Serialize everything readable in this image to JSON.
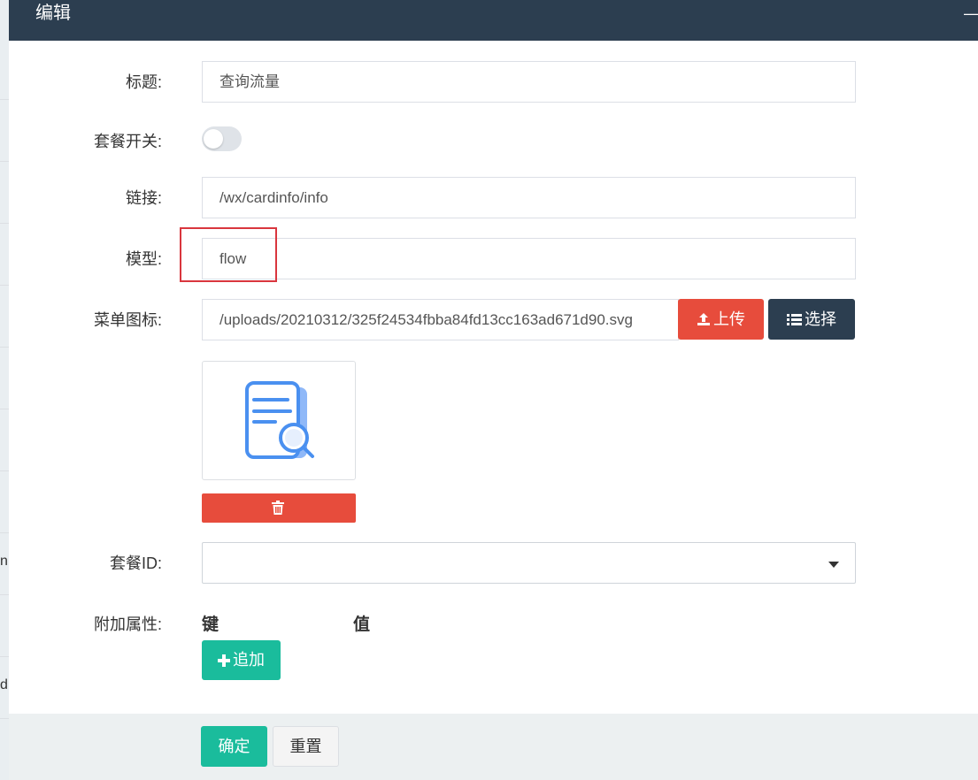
{
  "background": {
    "fragment_1": "n",
    "fragment_2": "d"
  },
  "dialog": {
    "title": "编辑",
    "minimize_icon": "minus-icon",
    "minimize_glyph": "—"
  },
  "form": {
    "title_label": "标题:",
    "title_value": "查询流量",
    "package_switch_label": "套餐开关:",
    "package_switch_on": false,
    "link_label": "链接:",
    "link_value": "/wx/cardinfo/info",
    "model_label": "模型:",
    "model_value": "flow",
    "menu_icon_label": "菜单图标:",
    "menu_icon_value": "/uploads/20210312/325f24534fbba84fd13cc163ad671d90.svg",
    "upload_label": "上传",
    "select_label": "选择",
    "package_id_label": "套餐ID:",
    "package_id_value": "",
    "extra_attrs_label": "附加属性:",
    "key_header": "键",
    "value_header": "值",
    "add_label": "追加"
  },
  "footer": {
    "confirm_label": "确定",
    "reset_label": "重置"
  },
  "colors": {
    "header": "#2c3e50",
    "danger": "#e74c3c",
    "success": "#1abc9c",
    "icon_blue": "#4a90f0",
    "highlight": "#d9363e"
  },
  "icons": {
    "upload": "upload-icon",
    "select": "list-icon",
    "delete": "trash-icon",
    "add": "plus-icon",
    "preview": "document-search-icon",
    "dropdown": "caret-down-icon"
  }
}
